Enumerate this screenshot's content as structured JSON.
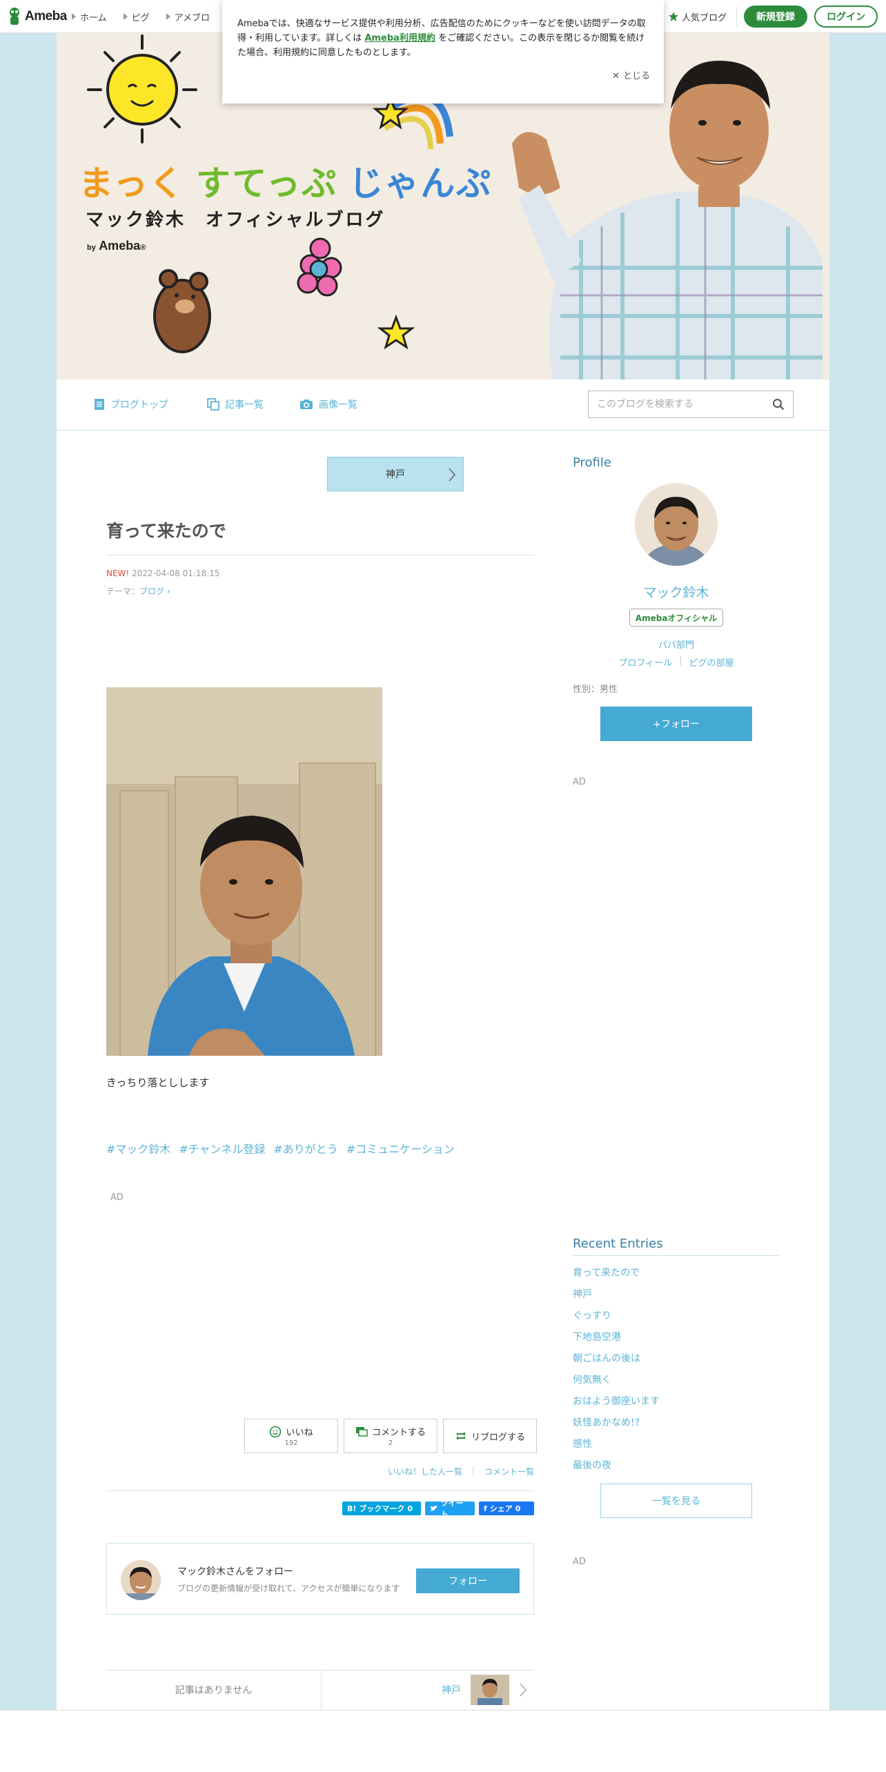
{
  "header": {
    "logo_text": "Ameba",
    "nav": [
      {
        "label": "ホーム"
      },
      {
        "label": "ピグ"
      },
      {
        "label": "アメブロ"
      }
    ],
    "popular_label": "人気ブログ",
    "signup_label": "新規登録",
    "login_label": "ログイン"
  },
  "cookie": {
    "text_before": "Amebaでは、快適なサービス提供や利用分析、広告配信のためにクッキーなどを使い訪問データの取得・利用しています。詳しくは ",
    "link": "Ameba利用規約",
    "text_after": " をご確認ください。この表示を閉じるか閲覧を続けた場合、利用規約に同意したものとします。",
    "close_label": "とじる"
  },
  "banner": {
    "title_1": "まっく",
    "title_2": "すてっぷ",
    "title_3": "じゃんぷ",
    "subtitle": "マック鈴木　オフィシャルブログ",
    "by_prefix": "by",
    "by_brand": "Ameba",
    "by_mark": "®"
  },
  "blognav": {
    "items": [
      {
        "label": "ブログトップ",
        "icon": "document-icon"
      },
      {
        "label": "記事一覧",
        "icon": "copy-icon"
      },
      {
        "label": "画像一覧",
        "icon": "camera-icon"
      }
    ],
    "search_placeholder": "このブログを検索する"
  },
  "article": {
    "theme_button": "神戸",
    "title": "育って来たので",
    "new_label": "NEW!",
    "date": "2022-04-08 01:18:15",
    "theme_prefix": "テーマ：",
    "theme_link": "ブログ",
    "body": "きっちり落としします",
    "hashtags": [
      "#マック鈴木",
      "#チャンネル登録",
      "#ありがとう",
      "#コミュニケーション"
    ],
    "ad_label": "AD",
    "actions": [
      {
        "label": "いいね",
        "count": "192",
        "icon": "smile-icon"
      },
      {
        "label": "コメントする",
        "count": "2",
        "icon": "comment-icon"
      },
      {
        "label": "リブログする",
        "count": "",
        "icon": "reblog-icon"
      }
    ],
    "likes_link": "いいね！した人一覧",
    "comments_link": "コメント一覧",
    "social": {
      "hatena": "ブックマーク",
      "hatena_count": "0",
      "tweet": "ツイート",
      "share": "シェア",
      "share_count": "0"
    },
    "follow_card": {
      "name": "マック鈴木さんをフォロー",
      "desc": "ブログの更新情報が受け取れて、アクセスが簡単になります",
      "button": "フォロー"
    },
    "pager": {
      "prev": "記事はありません",
      "next": "神戸"
    }
  },
  "sidebar": {
    "profile_title": "Profile",
    "name": "マック鈴木",
    "badge": "Amebaオフィシャル",
    "category": "パパ部門",
    "link_profile": "プロフィール",
    "link_room": "ピグの部屋",
    "sex": "性別：男性",
    "follow_button": "+フォロー",
    "ad_label": "AD",
    "recent_title": "Recent Entries",
    "recent": [
      "育って来たので",
      "神戸",
      "ぐっすり",
      "下地島空港",
      "朝ごはんの後は",
      "何気無く",
      "おはよう御座います",
      "妖怪あかなめ!?",
      "感性",
      "最後の夜"
    ],
    "see_all": "一覧を見る",
    "ad_label_2": "AD"
  },
  "colors": {
    "brand_green": "#2d8c3c",
    "accent_blue": "#45aad3",
    "link_blue": "#5bb4d6",
    "page_bg": "#cde6ee"
  }
}
